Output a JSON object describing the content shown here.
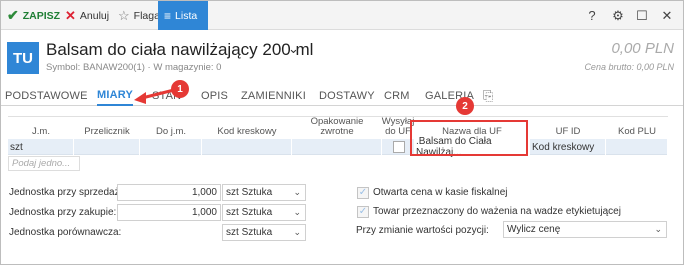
{
  "toolbar": {
    "save": "ZAPISZ",
    "cancel": "Anuluj",
    "flag": "Flaga",
    "list": "Lista",
    "help": "?"
  },
  "header": {
    "avatar": "TU",
    "title": "Balsam do ciała nawilżający 200 ml",
    "symbol": "Symbol: BANAW200(1)",
    "stock": "W magazynie: 0",
    "separator": "·",
    "price": "0,00 PLN",
    "gross_price": "Cena brutto: 0,00 PLN"
  },
  "tabs": [
    "PODSTAWOWE",
    "MIARY",
    "STAN",
    "OPIS",
    "ZAMIENNIKI",
    "DOSTAWY",
    "CRM",
    "GALERIA"
  ],
  "grid": {
    "headers": {
      "jm": "J.m.",
      "przelicznik": "Przelicznik",
      "do_jm": "Do j.m.",
      "kod_kreskowy": "Kod kreskowy",
      "opakowanie_1": "Opakowanie",
      "opakowanie_2": "zwrotne",
      "wysylaj_1": "Wysyłaj",
      "wysylaj_2": "do UF",
      "nazwa_uf": "Nazwa dla UF",
      "uf_id": "UF ID",
      "kod_plu": "Kod PLU"
    },
    "row": {
      "jm": "szt",
      "nazwa_uf": ".Balsam do Ciała Nawilżaj...",
      "uf_id": "Kod kreskowy"
    },
    "new_row_placeholder": "Podaj jedno..."
  },
  "form": {
    "sprzedaz_label": "Jednostka przy sprzedaży:",
    "sprzedaz_value": "1,000",
    "sprzedaz_unit_short": "szt",
    "sprzedaz_unit": "Sztuka",
    "zakup_label": "Jednostka przy zakupie:",
    "zakup_value": "1,000",
    "zakup_unit_short": "szt",
    "zakup_unit": "Sztuka",
    "porownawcza_label": "Jednostka porównawcza:",
    "porownawcza_unit_short": "szt",
    "porownawcza_unit": "Sztuka",
    "otwarta_cena": "Otwarta cena w kasie fiskalnej",
    "towar_wazenie": "Towar przeznaczony do ważenia na wadze etykietującej",
    "zmiana_label": "Przy zmianie wartości pozycji:",
    "zmiana_value": "Wylicz cenę"
  },
  "annotations": {
    "badge1": "1",
    "badge2": "2"
  },
  "colors": {
    "accent": "#2f86d6",
    "annotation": "#e53935",
    "save_green": "#1e7e34"
  }
}
